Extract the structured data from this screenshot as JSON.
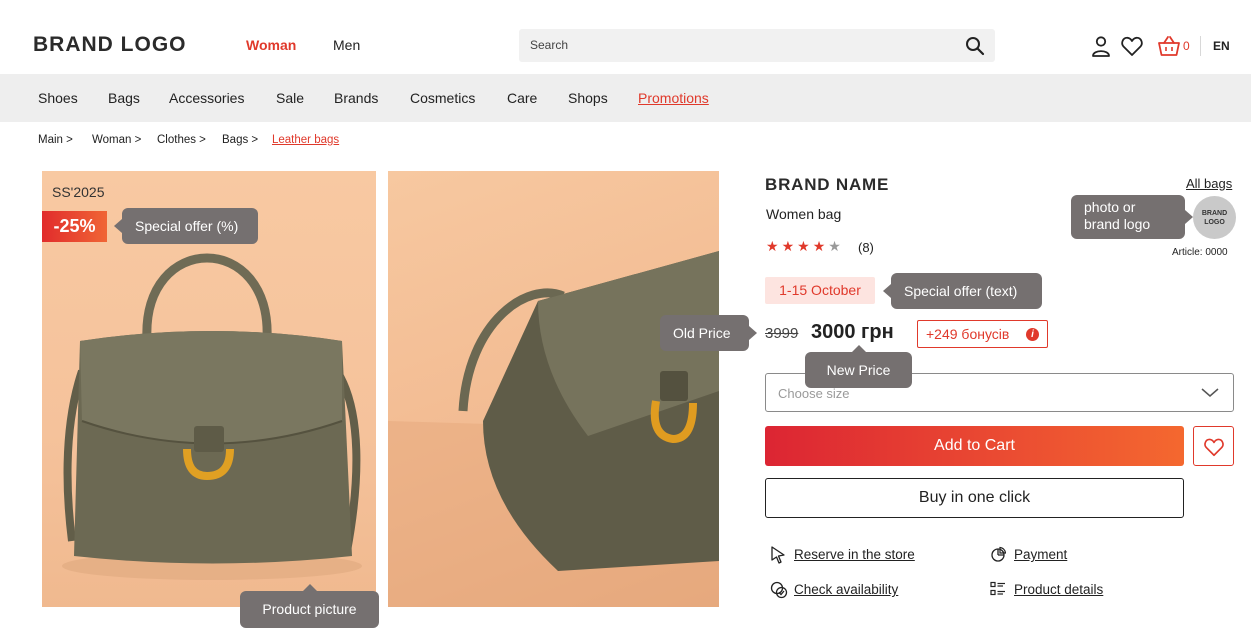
{
  "header": {
    "logo": "BRAND LOGO",
    "gender_tabs": [
      "Woman",
      "Men"
    ],
    "search_placeholder": "Search",
    "cart_count": "0",
    "language": "EN"
  },
  "categories": [
    "Shoes",
    "Bags",
    "Accessories",
    "Sale",
    "Brands",
    "Cosmetics",
    "Care",
    "Shops",
    "Promotions"
  ],
  "breadcrumbs": [
    "Main >",
    "Woman >",
    "Clothes >",
    "Bags >",
    "Leather bags"
  ],
  "gallery": {
    "season": "SS'2025",
    "discount": "-25%",
    "tip_offer_percent": "Special offer (%)",
    "tip_product_picture": "Product picture"
  },
  "product": {
    "brand_name": "BRAND NAME",
    "all_bags": "All bags",
    "title": "Women bag",
    "rating": 4,
    "rating_max": 5,
    "reviews": "(8)",
    "brand_logo_tip": "photo or\nbrand logo",
    "brand_logo_text": "BRAND\nLOGO",
    "article": "Article: 0000",
    "offer_date": "1-15 October",
    "tip_offer_text": "Special offer (text)",
    "tip_old_price": "Old Price",
    "old_price": "3999",
    "new_price": "3000 грн",
    "tip_new_price": "New Price",
    "bonus": "+249 бонусів",
    "size_placeholder": "Choose size",
    "add_to_cart": "Add to Cart",
    "buy_one_click": "Buy in one click",
    "links": {
      "reserve": "Reserve in the store",
      "payment": "Payment",
      "availability": "Check availability",
      "details": "Product details"
    }
  },
  "colors": {
    "accent": "#e0392b",
    "tooltip": "#757070",
    "nav_bg": "#eeeeee"
  }
}
